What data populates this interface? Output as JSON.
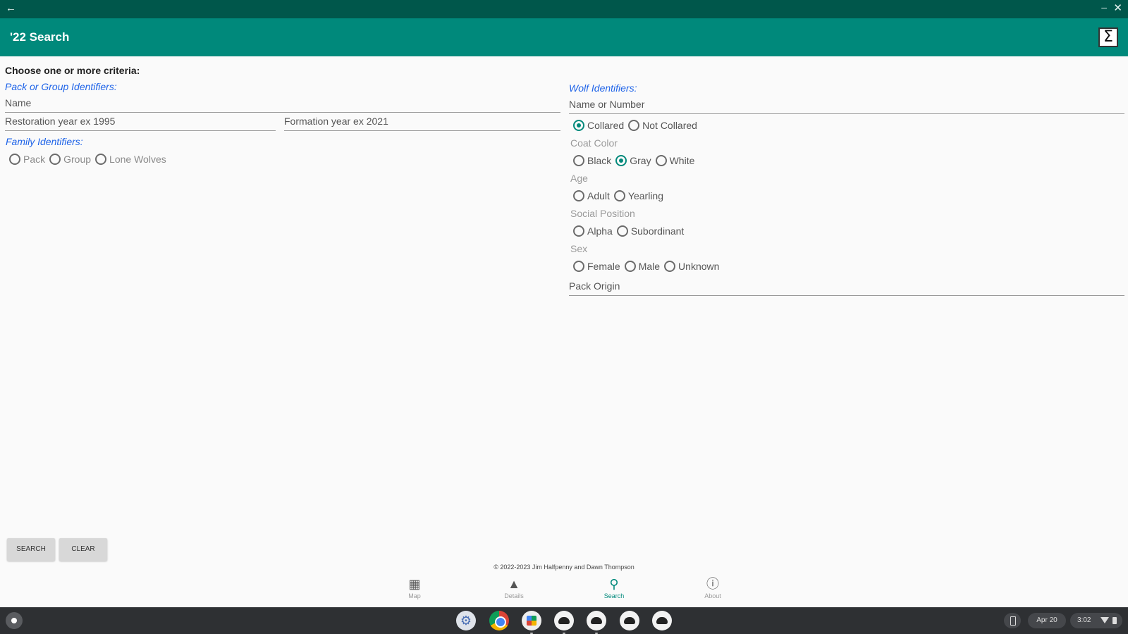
{
  "app_bar": {
    "title": "'22 Search"
  },
  "form": {
    "heading": "Choose one or more criteria:",
    "pack": {
      "label": "Pack or Group Identifiers:",
      "name_placeholder": "Name",
      "restoration_placeholder": "Restoration year ex 1995",
      "formation_placeholder": "Formation year ex 2021"
    },
    "family": {
      "label": "Family Identifiers:",
      "options": [
        "Pack",
        "Group",
        "Lone Wolves"
      ]
    },
    "wolf": {
      "label": "Wolf Identifiers:",
      "name_placeholder": "Name or Number",
      "collar_options": [
        "Collared",
        "Not Collared"
      ],
      "collar_selected": "Collared",
      "coat_label": "Coat Color",
      "coat_options": [
        "Black",
        "Gray",
        "White"
      ],
      "coat_selected": "Gray",
      "age_label": "Age",
      "age_options": [
        "Adult",
        "Yearling"
      ],
      "social_label": "Social Position",
      "social_options": [
        "Alpha",
        "Subordinant"
      ],
      "sex_label": "Sex",
      "sex_options": [
        "Female",
        "Male",
        "Unknown"
      ],
      "pack_origin_placeholder": "Pack Origin"
    }
  },
  "buttons": {
    "search": "SEARCH",
    "clear": "CLEAR"
  },
  "footer": {
    "copyright": "© 2022-2023 Jim Halfpenny and Dawn Thompson"
  },
  "bottom_nav": {
    "items": [
      {
        "label": "Map",
        "icon": "map-icon"
      },
      {
        "label": "Details",
        "icon": "wolf-icon"
      },
      {
        "label": "Search",
        "icon": "search-icon"
      },
      {
        "label": "About",
        "icon": "info-icon"
      }
    ],
    "active": "Search"
  },
  "shelf": {
    "date": "Apr 20",
    "time": "3:02"
  },
  "colors": {
    "status_bar": "#00574b",
    "app_bar": "#00897b",
    "accent": "#00897b",
    "group_label": "#1e63e8"
  }
}
